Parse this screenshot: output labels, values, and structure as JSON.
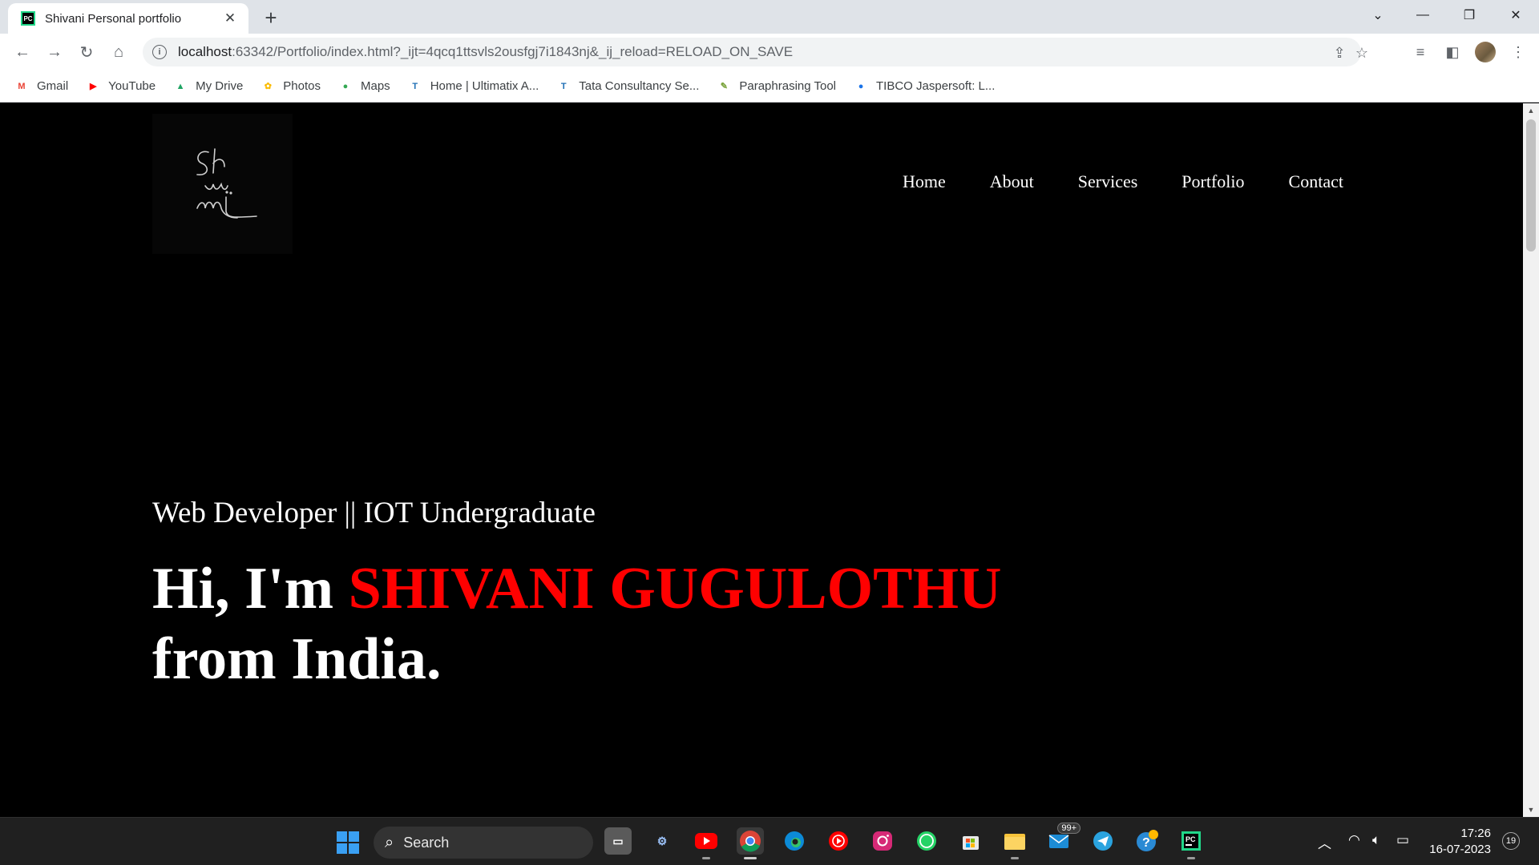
{
  "browser": {
    "tab_title": "Shivani Personal portfolio",
    "tab_favicon": "PC",
    "url_host": "localhost",
    "url_rest": ":63342/Portfolio/index.html?_ijt=4qcq1ttsvls2ousfgj7i1843nj&_ij_reload=RELOAD_ON_SAVE"
  },
  "bookmarks": [
    {
      "label": "Gmail",
      "icon": "gmail-icon",
      "glyph": "M",
      "color": "#ea4335"
    },
    {
      "label": "YouTube",
      "icon": "youtube-icon",
      "glyph": "▶",
      "color": "#ff0000"
    },
    {
      "label": "My Drive",
      "icon": "drive-icon",
      "glyph": "▲",
      "color": "#1fa463"
    },
    {
      "label": "Photos",
      "icon": "photos-icon",
      "glyph": "✿",
      "color": "#fbbc04"
    },
    {
      "label": "Maps",
      "icon": "maps-icon",
      "glyph": "●",
      "color": "#34a853"
    },
    {
      "label": "Home | Ultimatix A...",
      "icon": "tata-icon",
      "glyph": "T",
      "color": "#1f6fb5"
    },
    {
      "label": "Tata Consultancy Se...",
      "icon": "tata-icon",
      "glyph": "T",
      "color": "#1f6fb5"
    },
    {
      "label": "Paraphrasing Tool",
      "icon": "paraphrase-icon",
      "glyph": "✎",
      "color": "#7aa33c"
    },
    {
      "label": "TIBCO Jaspersoft: L...",
      "icon": "tibco-icon",
      "glyph": "●",
      "color": "#1a73e8"
    }
  ],
  "site": {
    "nav": [
      "Home",
      "About",
      "Services",
      "Portfolio",
      "Contact"
    ],
    "subtitle": "Web Developer || IOT Undergraduate",
    "greeting": "Hi, I'm ",
    "name": "SHIVANI GUGULOTHU",
    "location_line": "from India."
  },
  "taskbar": {
    "search_label": "Search",
    "mail_badge": "99+",
    "time": "17:26",
    "date": "16-07-2023",
    "notifications": "19"
  },
  "colors": {
    "accent_name": "#ff0000",
    "page_bg": "#000000"
  }
}
